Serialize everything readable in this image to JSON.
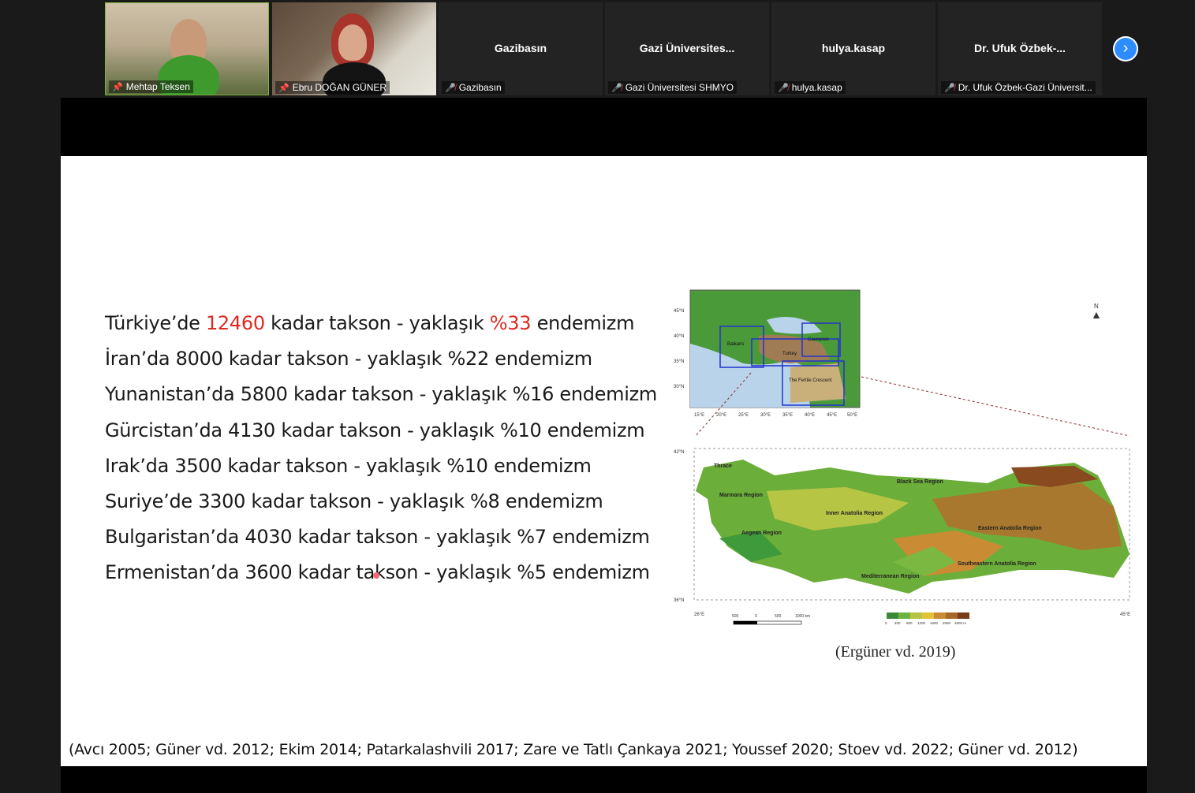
{
  "participants": [
    {
      "name": "",
      "label": "Mehtap Teksen",
      "video": true,
      "muted": false
    },
    {
      "name": "",
      "label": "Ebru DOĞAN GÜNER",
      "video": true,
      "muted": false
    },
    {
      "name": "Gazibasın",
      "label": "Gazibasın",
      "video": false,
      "muted": true
    },
    {
      "name": "Gazi Üniversites...",
      "label": "Gazi Üniversitesi SHMYO",
      "video": false,
      "muted": true
    },
    {
      "name": "hulya.kasap",
      "label": "hulya.kasap",
      "video": false,
      "muted": true
    },
    {
      "name": "Dr. Ufuk Özbek-...",
      "label": "Dr. Ufuk Özbek-Gazi Üniversit...",
      "video": false,
      "muted": true
    }
  ],
  "icons": {
    "pin": "pin-icon",
    "mic_off": "mic-off-icon",
    "next": "chevron-right-icon",
    "north": "north-arrow-icon"
  },
  "colors": {
    "accent": "#2d8cff",
    "highlight": "#e02a20",
    "muted_mic": "#e0393e"
  },
  "slide": {
    "lines": [
      {
        "pre": "Türkiye’de ",
        "num": "12460",
        "mid": " kadar takson - yaklaşık ",
        "pct": "%33",
        "post": " endemizm"
      },
      {
        "pre": "İran’da 8000 kadar takson - yaklaşık %22 endemizm",
        "num": "",
        "mid": "",
        "pct": "",
        "post": ""
      },
      {
        "pre": "Yunanistan’da 5800 kadar takson - yaklaşık %16 endemizm",
        "num": "",
        "mid": "",
        "pct": "",
        "post": ""
      },
      {
        "pre": "Gürcistan’da 4130 kadar takson - yaklaşık %10 endemizm",
        "num": "",
        "mid": "",
        "pct": "",
        "post": ""
      },
      {
        "pre": "Irak’da 3500 kadar takson - yaklaşık %10 endemizm",
        "num": "",
        "mid": "",
        "pct": "",
        "post": ""
      },
      {
        "pre": "Suriye’de 3300 kadar takson - yaklaşık %8 endemizm",
        "num": "",
        "mid": "",
        "pct": "",
        "post": ""
      },
      {
        "pre": "Bulgaristan’da 4030 kadar takson - yaklaşık %7 endemizm",
        "num": "",
        "mid": "",
        "pct": "",
        "post": ""
      },
      {
        "pre": "Ermenistan’da 3600 kadar takson - yaklaşık %5 endemizm",
        "num": "",
        "mid": "",
        "pct": "",
        "post": ""
      }
    ],
    "map_small": {
      "lat_labels": [
        "45°N",
        "40°N",
        "35°N",
        "30°N"
      ],
      "lon_labels": [
        "15°E",
        "20°E",
        "25°E",
        "30°E",
        "35°E",
        "40°E",
        "45°E",
        "50°E"
      ],
      "region_labels": [
        "Balkans",
        "Turkey",
        "Caucasus",
        "The Fertile Crescent"
      ]
    },
    "map_large": {
      "lat_labels": [
        "42°N",
        "36°N"
      ],
      "lon_labels": [
        "26°E",
        "45°E"
      ],
      "regions": [
        "Thrace",
        "Marmara Region",
        "Black Sea Region",
        "Inner Anatolia Region",
        "Aegean Region",
        "Eastern Anatolia Region",
        "Southeastern Anatolia Region",
        "Mediterranean Region"
      ],
      "scale_labels": [
        "500",
        "0",
        "500",
        "1000 km"
      ],
      "legend_labels": [
        "0",
        "400",
        "800",
        "1200",
        "1600",
        "2000",
        "2500 m"
      ]
    },
    "citation": "(Ergüner vd. 2019)",
    "references": "(Avcı 2005; Güner vd. 2012; Ekim 2014; Patarkalashvili 2017; Zare ve Tatlı Çankaya 2021; Youssef 2020; Stoev vd. 2022; Güner vd. 2012)",
    "north_label": "N"
  }
}
